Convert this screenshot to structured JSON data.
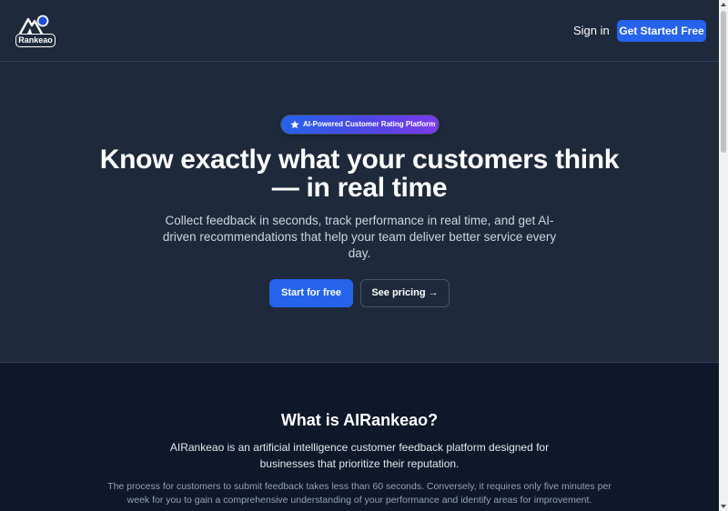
{
  "header": {
    "logo_text": "Rankeao",
    "signin_label": "Sign in",
    "cta_label": "Get Started Free"
  },
  "hero": {
    "badge": "AI-Powered Customer Rating Platform",
    "title": "Know exactly what your customers think — in real time",
    "subtitle": "Collect feedback in seconds, track performance in real time, and get AI-driven recommendations that help your team deliver better service every day.",
    "primary_button": "Start for free",
    "secondary_button": "See pricing →"
  },
  "about": {
    "title": "What is AIRankeao?",
    "lead": "AIRankeao is an artificial intelligence customer feedback platform designed for businesses that prioritize their reputation.",
    "body": "The process for customers to submit feedback takes less than 60 seconds. Conversely, it requires only five minutes per week for you to gain a comprehensive understanding of your performance and identify areas for improvement."
  },
  "colors": {
    "accent": "#2563eb",
    "hero_bg": "#1e293b",
    "section_bg": "#0f172a"
  },
  "icons": {
    "logo": "mountain-logo-icon",
    "badge": "star-icon"
  }
}
